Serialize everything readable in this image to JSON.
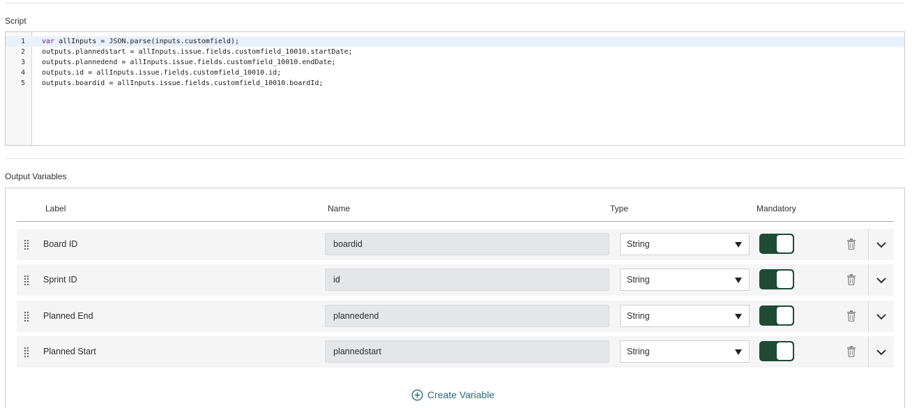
{
  "script_section": {
    "title": "Script",
    "lines": [
      {
        "no": "1",
        "keyword": "var",
        "code": " allInputs = JSON.parse(inputs.customfield);"
      },
      {
        "no": "2",
        "keyword": "",
        "code": "outputs.plannedstart = allInputs.issue.fields.customfield_10010.startDate;"
      },
      {
        "no": "3",
        "keyword": "",
        "code": "outputs.plannedend = allInputs.issue.fields.customfield_10010.endDate;"
      },
      {
        "no": "4",
        "keyword": "",
        "code": "outputs.id = allInputs.issue.fields.customfield_10010.id;"
      },
      {
        "no": "5",
        "keyword": "",
        "code": "outputs.boardid = allInputs.issue.fields.customfield_10010.boardId;"
      }
    ]
  },
  "output_variables": {
    "title": "Output Variables",
    "columns": {
      "label": "Label",
      "name": "Name",
      "type": "Type",
      "mandatory": "Mandatory"
    },
    "rows": [
      {
        "label": "Board ID",
        "name": "boardid",
        "type": "String",
        "mandatory": true
      },
      {
        "label": "Sprint ID",
        "name": "id",
        "type": "String",
        "mandatory": true
      },
      {
        "label": "Planned End",
        "name": "plannedend",
        "type": "String",
        "mandatory": true
      },
      {
        "label": "Planned Start",
        "name": "plannedstart",
        "type": "String",
        "mandatory": true
      }
    ],
    "create_label": "Create Variable"
  },
  "colors": {
    "toggle_on": "#1f4a36",
    "link": "#296b7a",
    "active_line": "#e8f1fc"
  },
  "icons": {
    "drag": "drag-handle-icon",
    "delete": "trash-icon",
    "expand": "chevron-down-icon",
    "create": "plus-circle-icon"
  }
}
